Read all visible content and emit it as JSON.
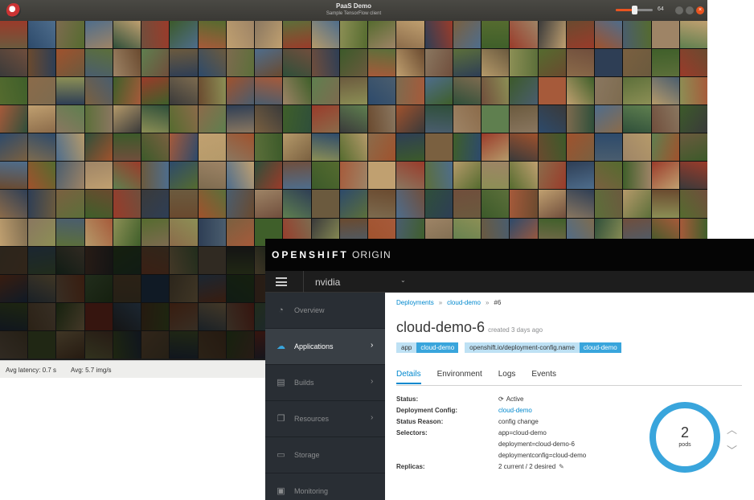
{
  "paas_window": {
    "title": "PaaS Demo",
    "subtitle": "Sample TensorFlow client",
    "batch_size": "64",
    "batch_slider_fraction": 0.5,
    "close_glyph": "×",
    "status": {
      "latency": "Avg latency: 0.7 s",
      "throughput": "Avg: 5.7 img/s"
    },
    "grid": {
      "columns": 25,
      "rows": 12,
      "bright_rows": 8,
      "tile_colors": [
        "#6b5a3e",
        "#3f5f2a",
        "#8a7760",
        "#2d4a6b",
        "#9a3b2a",
        "#5c6f3a",
        "#7d6b4f",
        "#3a3a3a",
        "#b59a6a",
        "#4e6d8c",
        "#6a4a2f",
        "#8c8f55",
        "#2f4f3a",
        "#a0522d",
        "#556b2f",
        "#704e3c",
        "#4a5d6e",
        "#8b6b4a",
        "#3c5a2a",
        "#9e8466",
        "#2e3e55",
        "#a65a3a",
        "#5f7f4f",
        "#7a6040",
        "#c0a070"
      ]
    }
  },
  "openshift": {
    "brand_bold": "OPENSHIFT",
    "brand_light": " ORIGIN",
    "project": "nvidia",
    "nav": [
      {
        "label": "Overview",
        "icon": "◔",
        "chevron": ""
      },
      {
        "label": "Applications",
        "icon": "☁",
        "chevron": "›"
      },
      {
        "label": "Builds",
        "icon": "▤",
        "chevron": "›"
      },
      {
        "label": "Resources",
        "icon": "❐",
        "chevron": "›"
      },
      {
        "label": "Storage",
        "icon": "▭",
        "chevron": ""
      },
      {
        "label": "Monitoring",
        "icon": "▣",
        "chevron": ""
      }
    ],
    "breadcrumb": {
      "deployments": "Deployments",
      "config": "cloud-demo",
      "current": "#6",
      "separator": "»"
    },
    "title": "cloud-demo-6",
    "created": "created 3 days ago",
    "labels": [
      {
        "key": "app",
        "value": "cloud-demo"
      },
      {
        "key": "openshift.io/deployment-config.name",
        "value": "cloud-demo"
      }
    ],
    "tabs": [
      "Details",
      "Environment",
      "Logs",
      "Events"
    ],
    "details": {
      "status_key": "Status:",
      "status_value": "Active",
      "config_key": "Deployment Config:",
      "config_value": "cloud-demo",
      "reason_key": "Status Reason:",
      "reason_value": "config change",
      "selectors_key": "Selectors:",
      "selectors": [
        "app=cloud-demo",
        "deployment=cloud-demo-6",
        "deploymentconfig=cloud-demo"
      ],
      "replicas_key": "Replicas:",
      "replicas_value": "2 current / 2 desired"
    },
    "pods": {
      "count": "2",
      "unit": "pods",
      "ring_color": "#39a5dc"
    },
    "glyphs": {
      "sync": "⟳",
      "edit": "✎",
      "up": "︿",
      "down": "﹀",
      "chevron_down": "⌄"
    }
  }
}
